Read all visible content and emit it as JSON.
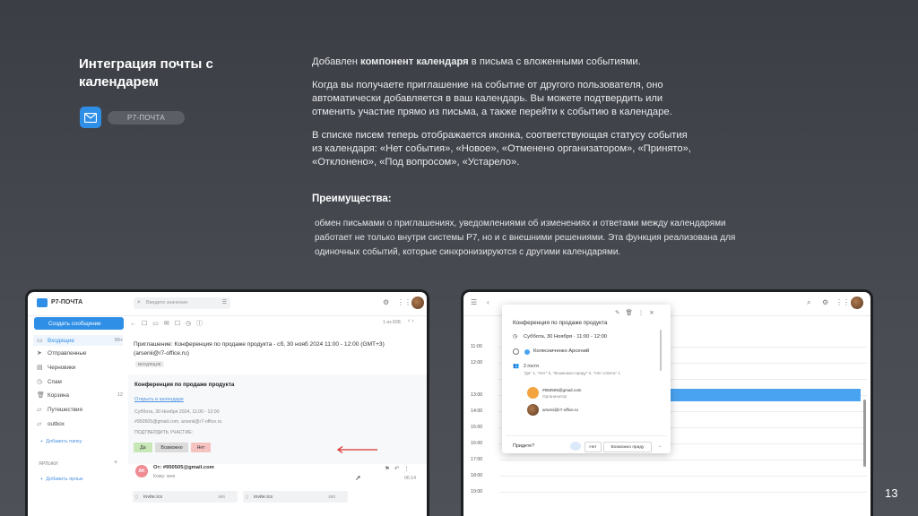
{
  "slide": {
    "title": "Интеграция почты с календарем",
    "app_label": "Р7-ПОЧТА",
    "para1_prefix": "Добавлен ",
    "para1_bold": "компонент календаря",
    "para1_suffix": " в письма с вложенными событиями.",
    "para2": "Когда вы получаете приглашение на событие от другого пользователя, оно автоматически добавляется в ваш календарь. Вы можете подтвердить или отменить участие прямо из письма, а также перейти к событию в календаре.",
    "para3": "В списке писем теперь отображается иконка, соответствующая статусу события из календаря: «Нет события», «Новое», «Отменено организатором», «Принято», «Отклонено», «Под вопросом», «Устарело».",
    "advantages_title": "Преимущества:",
    "advantages_text": "обмен письмами о приглашениях, уведомлениями об изменениях и ответами между календарями работает не только внутри системы Р7, но и с внешними решениями. Эта функция реализована для одиночных событий, которые синхронизируются с другими календарями.",
    "page_number": "13"
  },
  "mail": {
    "logo": "Р7-ПОЧТА",
    "search_placeholder": "Введите значение",
    "compose": "Создать сообщение",
    "pager": "1 из 608",
    "folders": [
      {
        "label": "Входящие",
        "count": "99+"
      },
      {
        "label": "Отправленные",
        "count": ""
      },
      {
        "label": "Черновики",
        "count": ""
      },
      {
        "label": "Спам",
        "count": ""
      },
      {
        "label": "Корзина",
        "count": "12"
      },
      {
        "label": "Путешествия",
        "count": ""
      },
      {
        "label": "outbox",
        "count": ""
      }
    ],
    "add_folder": "Добавить папку",
    "labels_section": "ЯРЛЫКИ",
    "add_label": "Добавить ярлык",
    "subject": "Приглашение: Конференция по продаже продукта - сб, 30 нояб 2024 11:00 - 12:00 (GMT+3) (arsenii@r7-office.ru)",
    "tag": "ВХОДЯЩИЕ",
    "invite_title": "Конференция по продаже продукта",
    "open_calendar": "Открыть в календаре",
    "invite_date": "Суббота, 30 Ноября 2024, 11:00 - 12:00",
    "invite_attendees": "#950505@gmail.com, arsenii@r7-office.ru",
    "confirm_label": "ПОДТВЕРДИТЬ УЧАСТИЕ:",
    "btn_yes": "Да",
    "btn_maybe": "Возможно",
    "btn_no": "Нет",
    "sender_initials": "AK",
    "sender": "От: #950505@gmail.com",
    "recipient": "Кому: мне",
    "time": "06:14",
    "attachments": [
      {
        "name": "invite.ics",
        "size": "2Кб"
      },
      {
        "name": "invite.ics",
        "size": "2Кб"
      }
    ]
  },
  "calendar": {
    "times": [
      "11:00",
      "12:00",
      "13:00",
      "14:00",
      "15:00",
      "16:00",
      "17:00",
      "18:00",
      "19:00"
    ],
    "popup_title": "Конференция по продаже продукта",
    "popup_date": "Суббота, 30 Ноября · 11:00 - 12:00",
    "organizer_name": "Колесниченко Арсений",
    "guests_count": "2 гостя",
    "guests_summary": "\"Да\" 1, \"Нет\" 0, \"Возможно приду\" 0, \"Нет ответа\" 1",
    "guest1_email": "#950505@gmail.com",
    "guest1_role": "Организатор",
    "guest2_email": "arsenii@r7-office.ru",
    "will_you_come": "Придете?",
    "btn_no": "Нет",
    "btn_maybe": "Возможно приду"
  },
  "colors": {
    "accent": "#2f8fe6",
    "yes": "#c7e8b6",
    "no": "#f6c3c1",
    "arrow": "#d9302f"
  }
}
